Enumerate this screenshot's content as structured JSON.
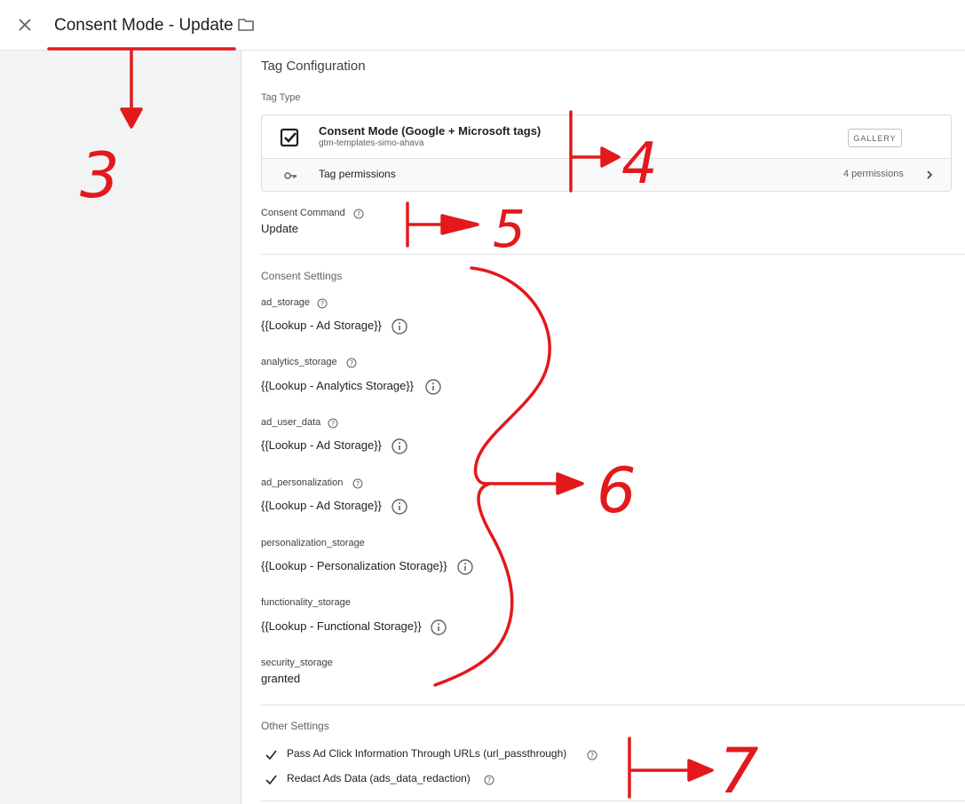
{
  "header": {
    "tag_name": "Consent Mode - Update"
  },
  "tag_configuration": {
    "title": "Tag Configuration",
    "tag_type_label": "Tag Type",
    "template": {
      "name": "Consent Mode (Google + Microsoft tags)",
      "publisher": "gtm-templates-simo-ahava",
      "gallery_label": "GALLERY"
    },
    "permissions": {
      "label": "Tag permissions",
      "count_text": "4 permissions"
    },
    "consent_command": {
      "label": "Consent Command",
      "value": "Update"
    }
  },
  "consent_settings": {
    "title": "Consent Settings",
    "items": [
      {
        "label": "ad_storage",
        "value": "{{Lookup - Ad Storage}}"
      },
      {
        "label": "analytics_storage",
        "value": "{{Lookup - Analytics Storage}}"
      },
      {
        "label": "ad_user_data",
        "value": "{{Lookup - Ad Storage}}"
      },
      {
        "label": "ad_personalization",
        "value": "{{Lookup - Ad Storage}}"
      },
      {
        "label": "personalization_storage",
        "value": "{{Lookup - Personalization Storage}}"
      },
      {
        "label": "functionality_storage",
        "value": "{{Lookup - Functional Storage}}"
      },
      {
        "label": "security_storage",
        "value": "granted"
      }
    ]
  },
  "other_settings": {
    "title": "Other Settings",
    "items": [
      {
        "label": "Pass Ad Click Information Through URLs (url_passthrough)"
      },
      {
        "label": "Redact Ads Data (ads_data_redaction)"
      }
    ]
  },
  "annotations": {
    "labels": [
      "3",
      "4",
      "5",
      "6",
      "7"
    ],
    "color": "#e3191c"
  },
  "icons": [
    "close-icon",
    "folder-icon",
    "checkbox-template-icon",
    "key-icon",
    "chevron-right-icon",
    "help-icon",
    "info-icon",
    "checkmark-icon"
  ]
}
